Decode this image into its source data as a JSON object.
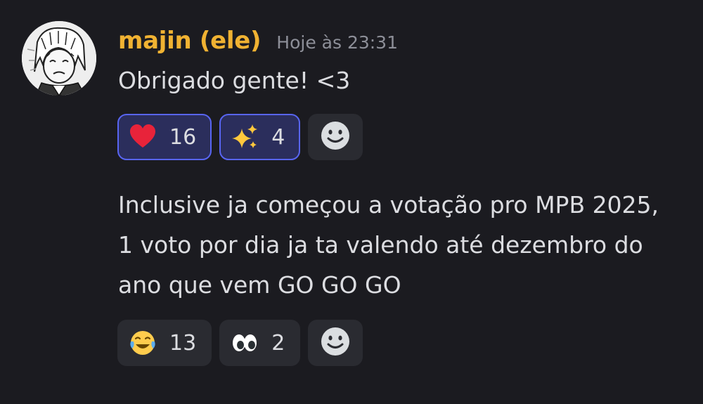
{
  "message": {
    "username": "majin (ele)",
    "timestamp": "Hoje às 23:31",
    "avatar_icon": "avatar-drawing-icon",
    "first_text": "Obrigado gente! <3",
    "first_reactions": [
      {
        "emoji": "red-heart-icon",
        "count": "16",
        "active": true
      },
      {
        "emoji": "sparkles-icon",
        "count": "4",
        "active": true
      }
    ],
    "second_text": "Inclusive ja começou a votação pro MPB 2025, 1 voto por dia ja ta valendo até dezembro do ano que vem GO GO GO",
    "second_reactions": [
      {
        "emoji": "face-with-tears-of-joy-icon",
        "count": "13",
        "active": false
      },
      {
        "emoji": "eyes-icon",
        "count": "2",
        "active": false
      }
    ],
    "add_reaction_icon": "add-reaction-smiley-icon"
  },
  "colors": {
    "background": "#1b1b20",
    "username": "#f0b232",
    "active_reaction_bg": "#2b2e5c",
    "active_reaction_border": "#5865f2",
    "reaction_bg": "#2a2b31"
  }
}
